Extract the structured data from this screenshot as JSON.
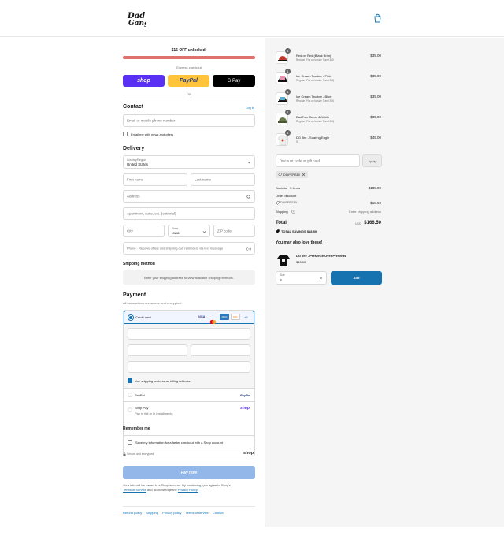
{
  "header": {
    "logo_text": "DadGang",
    "cart_icon": "bag-icon"
  },
  "banner": {
    "text": "$15 OFF unlocked!",
    "color": "#e2706c"
  },
  "express": {
    "label": "Express checkout",
    "shop_label": "shop",
    "paypal_label": "PayPal",
    "gpay_label": "G Pay",
    "or_label": "OR"
  },
  "contact": {
    "title": "Contact",
    "login_link": "Log in",
    "email_placeholder": "Email or mobile phone number",
    "news_label": "Email me with news and offers"
  },
  "delivery": {
    "title": "Delivery",
    "country_label": "Country/Region",
    "country_value": "United States",
    "first_name": "First name",
    "last_name": "Last name",
    "address": "Address",
    "apartment": "Apartment, suite, etc. (optional)",
    "city": "City",
    "state_label": "State",
    "state_value": "Iowa",
    "zip": "ZIP code",
    "phone": "Phone · Receive offers and shipping cart reminders via text message"
  },
  "shipping": {
    "title": "Shipping method",
    "note": "Enter your shipping address to view available shipping methods."
  },
  "payment": {
    "title": "Payment",
    "subtitle": "All transactions are secure and encrypted.",
    "credit_card": "Credit card",
    "card_brands": [
      "VISA",
      "MC",
      "AMEX",
      "DISC"
    ],
    "more_cards": "+5",
    "billing_label": "Use shipping address as billing address",
    "paypal": "PayPal",
    "paypal_logo": "PayPal",
    "shoppay": "Shop Pay",
    "shoppay_sub": "Pay in full or in installments",
    "shoppay_logo": "shop"
  },
  "remember": {
    "title": "Remember me",
    "save_label": "Save my information for a faster checkout with a Shop account",
    "secure": "Secure and encrypted",
    "shop_logo": "shop"
  },
  "pay_button": "Pay now",
  "legal": {
    "line1": "Your info will be saved to a Shop account. By continuing, you agree to Shop's",
    "terms": "Terms of Service",
    "and": "and acknowledge the",
    "privacy": "Privacy Policy."
  },
  "footer_links": [
    "Refund policy",
    "Shipping",
    "Privacy policy",
    "Terms of service",
    "Contact"
  ],
  "cart": {
    "items": [
      {
        "name": "Red on Red (Black Brim)",
        "variant": "Regular (Fits up to size 7 and 3/4)",
        "price": "$35.00",
        "qty": "1",
        "color": "#c0392b"
      },
      {
        "name": "Ice Cream Trucker - Pink",
        "variant": "Regular (Fits up to size 7 and 3/4)",
        "price": "$35.00",
        "qty": "1",
        "color": "#e891b0"
      },
      {
        "name": "Ice Cream Trucker - Blue",
        "variant": "Regular (Fits up to size 7 and 3/4)",
        "price": "$35.00",
        "qty": "1",
        "color": "#5aa9d6"
      },
      {
        "name": "DadTree Camo & White",
        "variant": "Regular (Fits up to size 7 and 3/4)",
        "price": "$35.00",
        "qty": "1",
        "color": "#6b7a4a"
      },
      {
        "name": "DG Tee - Soaring Eagle",
        "variant": "S",
        "price": "$45.00",
        "qty": "1",
        "color": "#dddddd"
      }
    ],
    "discount_placeholder": "Discount code or gift card",
    "apply": "Apply",
    "code": "DIAPERS10",
    "subtotal_label": "Subtotal · 5 items",
    "subtotal": "$185.00",
    "order_discount": "Order discount",
    "discount_code": "DIAPERS10",
    "discount_amount": "– $18.50",
    "shipping_label": "Shipping",
    "shipping_value": "Enter shipping address",
    "total_label": "Total",
    "currency": "USD",
    "total": "$166.50",
    "savings": "TOTAL SAVINGS $18.50",
    "upsell_title": "You may also love these!",
    "upsell_name": "DG Tee - Presence Over Presents",
    "upsell_price": "$45.00",
    "size_label": "Size",
    "size_value": "S",
    "add": "Add"
  }
}
